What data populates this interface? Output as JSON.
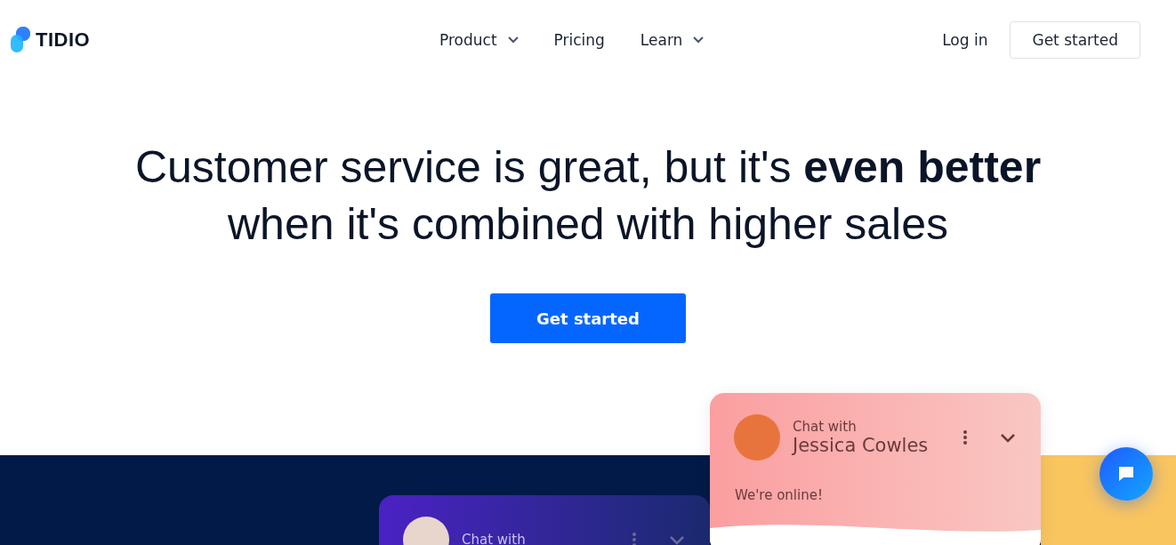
{
  "logo": {
    "text": "TIDIO"
  },
  "nav": [
    {
      "label": "Product",
      "dropdown": true
    },
    {
      "label": "Pricing",
      "dropdown": false
    },
    {
      "label": "Learn",
      "dropdown": true
    }
  ],
  "header_actions": {
    "login": "Log in",
    "cta": "Get started"
  },
  "hero": {
    "title": "Customer service is great, but it's **even better** when it's combined with higher sales",
    "cta": "Get started"
  },
  "chat_cards": [
    {
      "label": "Chat with",
      "name": "Jessica Cowles",
      "status": "We're online!",
      "kind": "light"
    },
    {
      "label": "Chat with",
      "kind": "dark"
    }
  ]
}
